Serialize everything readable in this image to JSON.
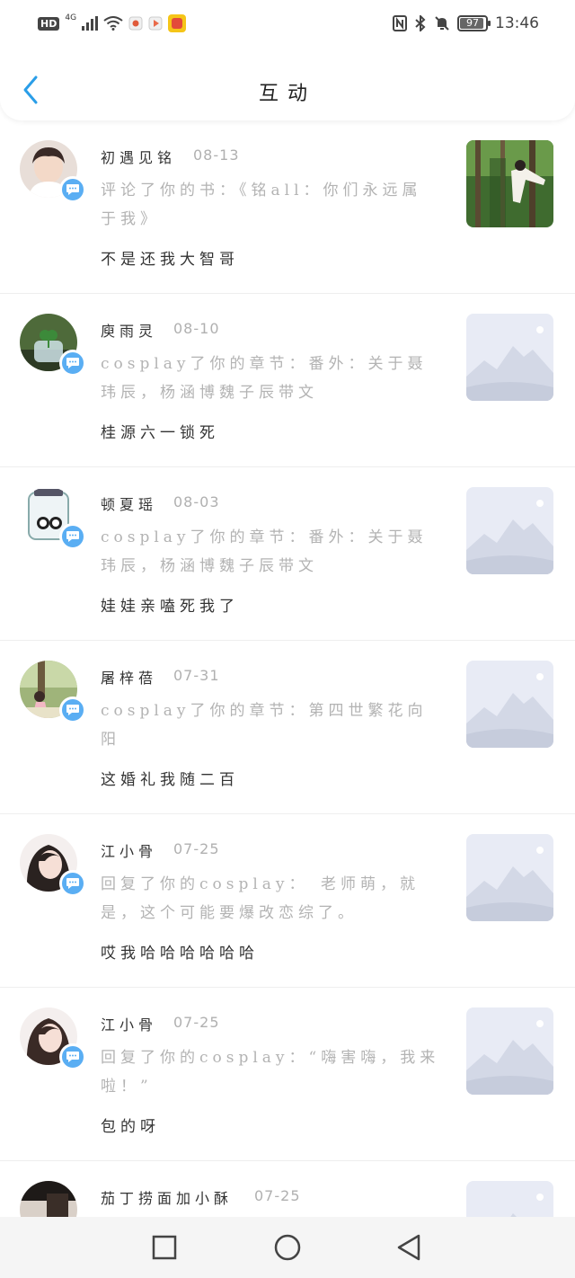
{
  "status_bar": {
    "hd": "HD",
    "network": "4G",
    "battery": "97",
    "time": "13:46"
  },
  "nav": {
    "title": "互动"
  },
  "items": [
    {
      "name": "初遇见铭",
      "date": "08-13",
      "action": "评论了你的书：《铭all：你们永远属于我》",
      "reply": "不是还我大智哥",
      "thumb": "photo"
    },
    {
      "name": "庾雨灵",
      "date": "08-10",
      "action": "cosplay了你的章节：番外：关于聂玮辰，杨涵博魏子辰带文",
      "reply": "桂源六一锁死",
      "thumb": "placeholder"
    },
    {
      "name": "顿夏瑶",
      "date": "08-03",
      "action": "cosplay了你的章节：番外：关于聂玮辰，杨涵博魏子辰带文",
      "reply": "娃娃亲嗑死我了",
      "thumb": "placeholder"
    },
    {
      "name": "屠梓蓓",
      "date": "07-31",
      "action": "cosplay了你的章节：第四世繁花向阳",
      "reply": "这婚礼我随二百",
      "thumb": "placeholder"
    },
    {
      "name": "江小骨",
      "date": "07-25",
      "action": "回复了你的cosplay：　老师萌，就是，这个可能要爆改恋综了。",
      "reply": "哎我哈哈哈哈哈哈",
      "thumb": "placeholder"
    },
    {
      "name": "江小骨",
      "date": "07-25",
      "action": "回复了你的cosplay：“嗨害嗨，我来啦！”",
      "reply": "包的呀",
      "thumb": "placeholder"
    },
    {
      "name": "茄丁捞面加小酥",
      "date": "07-25",
      "action": "",
      "reply": "",
      "thumb": "placeholder"
    }
  ],
  "colors": {
    "accent": "#2a9ee8",
    "badge": "#5aaef3",
    "muted_text": "#b3b3b3"
  },
  "icons": {
    "back": "chevron-left-icon",
    "comment_badge": "speech-bubble-icon",
    "nav_recent": "square-icon",
    "nav_home": "circle-icon",
    "nav_back": "triangle-icon"
  }
}
